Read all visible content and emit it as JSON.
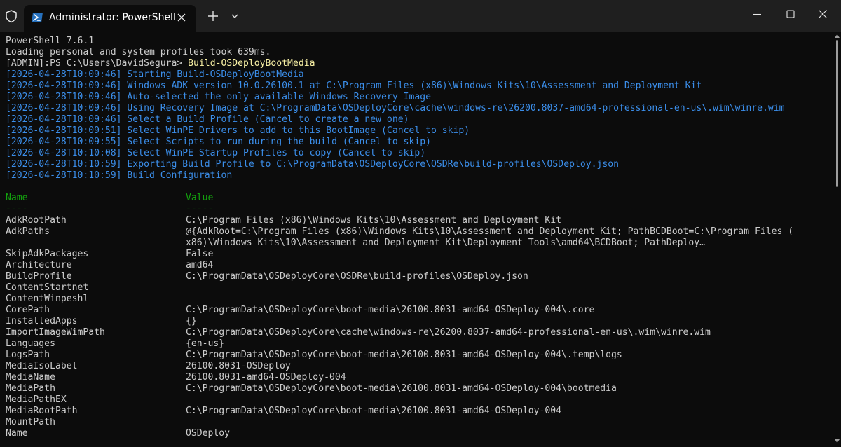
{
  "titlebar": {
    "tab_title": "Administrator: PowerShell"
  },
  "icons": {
    "shield": "shield-icon",
    "tab": "powershell-icon",
    "close_tab": "close-icon",
    "new_tab": "plus-icon",
    "dropdown": "chevron-down-icon",
    "minimize": "minimize-icon",
    "maximize": "maximize-icon",
    "close_window": "close-icon"
  },
  "colors": {
    "background": "#0c0c0c",
    "titlebar": "#1f1f1f",
    "text": "#cccccc",
    "command": "#f9f1a5",
    "log": "#3b8eea",
    "header": "#13a10e"
  },
  "console": {
    "version": "PowerShell 7.6.1",
    "profile_load": "Loading personal and system profiles took 639ms.",
    "prompt": "[ADMIN]:PS C:\\Users\\DavidSegura> ",
    "command": "Build-OSDeployBootMedia",
    "log": [
      "[2026-04-28T10:09:46] Starting Build-OSDeployBootMedia",
      "[2026-04-28T10:09:46] Windows ADK version 10.0.26100.1 at C:\\Program Files (x86)\\Windows Kits\\10\\Assessment and Deployment Kit",
      "[2026-04-28T10:09:46] Auto-selected the only available Windows Recovery Image",
      "[2026-04-28T10:09:46] Using Recovery Image at C:\\ProgramData\\OSDeployCore\\cache\\windows-re\\26200.8037-amd64-professional-en-us\\.wim\\winre.wim",
      "[2026-04-28T10:09:46] Select a Build Profile (Cancel to create a new one)",
      "[2026-04-28T10:09:51] Select WinPE Drivers to add to this BootImage (Cancel to skip)",
      "[2026-04-28T10:09:55] Select Scripts to run during the build (Cancel to skip)",
      "[2026-04-28T10:10:08] Select WinPE Startup Profiles to copy (Cancel to skip)",
      "[2026-04-28T10:10:59] Exporting Build Profile to C:\\ProgramData\\OSDeployCore\\OSDRe\\build-profiles\\OSDeploy.json",
      "[2026-04-28T10:10:59] Build Configuration"
    ],
    "table": {
      "name_header": "Name",
      "value_header": "Value",
      "name_rule": "----",
      "value_rule": "-----",
      "rows": [
        {
          "name": "AdkRootPath",
          "value": "C:\\Program Files (x86)\\Windows Kits\\10\\Assessment and Deployment Kit"
        },
        {
          "name": "AdkPaths",
          "value": "@{AdkRoot=C:\\Program Files (x86)\\Windows Kits\\10\\Assessment and Deployment Kit; PathBCDBoot=C:\\Program Files ("
        },
        {
          "name": "",
          "value": "x86)\\Windows Kits\\10\\Assessment and Deployment Kit\\Deployment Tools\\amd64\\BCDBoot; PathDeploy…"
        },
        {
          "name": "SkipAdkPackages",
          "value": "False"
        },
        {
          "name": "Architecture",
          "value": "amd64"
        },
        {
          "name": "BuildProfile",
          "value": "C:\\ProgramData\\OSDeployCore\\OSDRe\\build-profiles\\OSDeploy.json"
        },
        {
          "name": "ContentStartnet",
          "value": ""
        },
        {
          "name": "ContentWinpeshl",
          "value": ""
        },
        {
          "name": "CorePath",
          "value": "C:\\ProgramData\\OSDeployCore\\boot-media\\26100.8031-amd64-OSDeploy-004\\.core"
        },
        {
          "name": "InstalledApps",
          "value": "{}"
        },
        {
          "name": "ImportImageWimPath",
          "value": "C:\\ProgramData\\OSDeployCore\\cache\\windows-re\\26200.8037-amd64-professional-en-us\\.wim\\winre.wim"
        },
        {
          "name": "Languages",
          "value": "{en-us}"
        },
        {
          "name": "LogsPath",
          "value": "C:\\ProgramData\\OSDeployCore\\boot-media\\26100.8031-amd64-OSDeploy-004\\.temp\\logs"
        },
        {
          "name": "MediaIsoLabel",
          "value": "26100.8031-OSDeploy"
        },
        {
          "name": "MediaName",
          "value": "26100.8031-amd64-OSDeploy-004"
        },
        {
          "name": "MediaPath",
          "value": "C:\\ProgramData\\OSDeployCore\\boot-media\\26100.8031-amd64-OSDeploy-004\\bootmedia"
        },
        {
          "name": "MediaPathEX",
          "value": ""
        },
        {
          "name": "MediaRootPath",
          "value": "C:\\ProgramData\\OSDeployCore\\boot-media\\26100.8031-amd64-OSDeploy-004"
        },
        {
          "name": "MountPath",
          "value": ""
        },
        {
          "name": "Name",
          "value": "OSDeploy"
        }
      ]
    }
  }
}
